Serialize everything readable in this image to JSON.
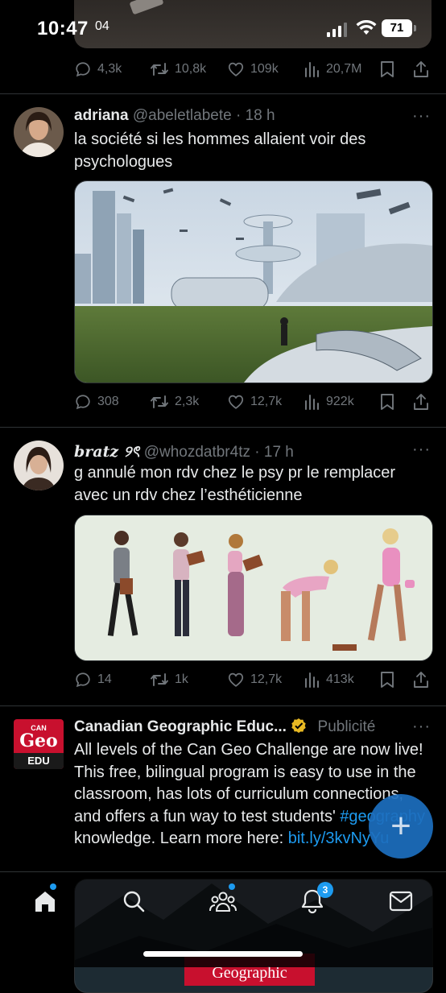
{
  "status": {
    "time": "10:47",
    "overlay_time": "04",
    "battery": "71"
  },
  "top_tweet": {
    "actions": {
      "replies": "4,3k",
      "retweets": "10,8k",
      "likes": "109k",
      "views": "20,7M"
    }
  },
  "tweets": [
    {
      "name": "adriana",
      "handle": "@abeletlabete",
      "time": "· 18 h",
      "text": "la société si les hommes allaient voir des psychologues",
      "actions": {
        "replies": "308",
        "retweets": "2,3k",
        "likes": "12,7k",
        "views": "922k"
      }
    },
    {
      "name": "bratz ୨ৎ",
      "handle": "@whozdatbr4tz",
      "time": "· 17 h",
      "text": "g annulé mon rdv chez le psy pr le remplacer avec un rdv chez l’esthéticienne",
      "actions": {
        "replies": "14",
        "retweets": "1k",
        "likes": "12,7k",
        "views": "413k"
      }
    }
  ],
  "ad": {
    "logo_top": "CAN",
    "logo_main": "Geo",
    "logo_bottom": "EDU",
    "name": "Canadian Geographic Educ...",
    "label": "Publicité",
    "text_before": "All levels of the Can Geo Challenge are now live! This free, bilingual program is easy to use in the classroom, has lots of curriculum connections, and offers a fun way to test students' ",
    "hashtag": "#geography",
    "text_middle": " knowledge. Learn more here: ",
    "url": "bit.ly/3kvNyYu",
    "media_caption": "Geographic"
  },
  "more_label": "···",
  "fab_label": "+",
  "tabbar": {
    "notifications_badge": "3"
  },
  "colors": {
    "accent": "#1d9bf0",
    "muted": "#71767b",
    "background": "#000000",
    "ad_red": "#c8102e"
  },
  "icons": [
    "reply-icon",
    "retweet-icon",
    "like-icon",
    "views-icon",
    "bookmark-icon",
    "share-icon",
    "home-icon",
    "search-icon",
    "communities-icon",
    "notifications-icon",
    "messages-icon",
    "verified-icon"
  ]
}
